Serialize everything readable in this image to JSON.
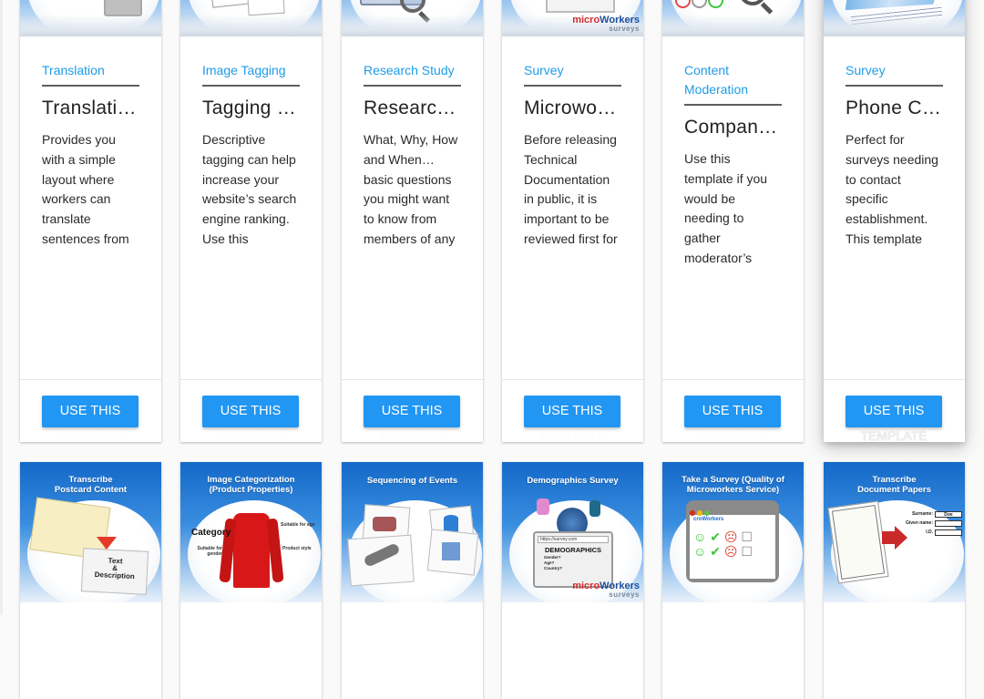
{
  "button_label_line1": "USE THIS",
  "button_label_line2": "TEMPLATE",
  "brand": {
    "micro": "micro",
    "workers": "Workers",
    "surveys": "surveys"
  },
  "top_cards": [
    {
      "category": "Translation",
      "title": "Translation Template",
      "title_display": "Translati…",
      "description": "Provides you with a simple layout where workers can translate sentences from one to language another.",
      "thumb_icon": "keyboard-icon"
    },
    {
      "category": "Image Tagging",
      "title": "Tagging Template",
      "title_display": "Tagging …",
      "description": "Descriptive tagging can help increase your website’s search engine ranking. Use this template to get tags.",
      "thumb_icon": "tag-card-icon"
    },
    {
      "category": "Research Study",
      "title": "Research Study",
      "title_display": "Research…",
      "description": "What, Why, How and When… basic questions you might want to know from members of any Organization.",
      "thumb_icon": "magnifier-icon"
    },
    {
      "category": "Survey",
      "title": "Microworkers Survey",
      "title_display": "Microwor…",
      "description": "Before releasing Technical Documentation in public, it is important to be reviewed first for its clarity.",
      "thumb_icon": "checklist-icon"
    },
    {
      "category": "Content Moderation",
      "title": "Company Moderation",
      "title_display": "Compan…",
      "description": "Use this template if you would be needing to gather moderator’s opinions.",
      "thumb_icon": "smiley-rating-icon"
    },
    {
      "category": "Survey",
      "title": "Phone Call Survey",
      "title_display": "Phone C…",
      "description": "Perfect for surveys needing to contact specific establishment. This template contains a short form.",
      "thumb_icon": "map-code-icon"
    }
  ],
  "bottom_cards": [
    {
      "thumb_title": "Transcribe Postcard Content",
      "thumb_title_l1": "Transcribe",
      "thumb_title_l2": "Postcard Content",
      "thumb_text_l1": "Text",
      "thumb_text_l2": "&",
      "thumb_text_l3": "Description"
    },
    {
      "thumb_title": "Image Categorization (Product Properties)",
      "thumb_title_l1": "Image Categorization",
      "thumb_title_l2": "(Product Properties)",
      "labels": [
        "Category",
        "Suitable for age",
        "Suitable for gender",
        "Product style"
      ]
    },
    {
      "thumb_title": "Sequencing of Events",
      "thumb_title_l1": "Sequencing of Events",
      "thumb_title_l2": ""
    },
    {
      "thumb_title": "Demographics Survey",
      "thumb_title_l1": "Demographics Survey",
      "thumb_title_l2": "",
      "url": "https://survey.com",
      "form_title": "DEMOGRAPHICS",
      "fields": [
        "Gender?",
        "Age?",
        "Country?"
      ]
    },
    {
      "thumb_title": "Take a Survey (Quality of Microworkers Service)",
      "thumb_title_l1": "Take a Survey (Quality of",
      "thumb_title_l2": "Microworkers Service)",
      "app_name": "croWorkers"
    },
    {
      "thumb_title": "Transcribe Document Papers",
      "thumb_title_l1": "Transcribe",
      "thumb_title_l2": "Document Papers",
      "fields": [
        "Surname:",
        "Given name:",
        "I.D."
      ],
      "surname_value": "Doe"
    }
  ]
}
